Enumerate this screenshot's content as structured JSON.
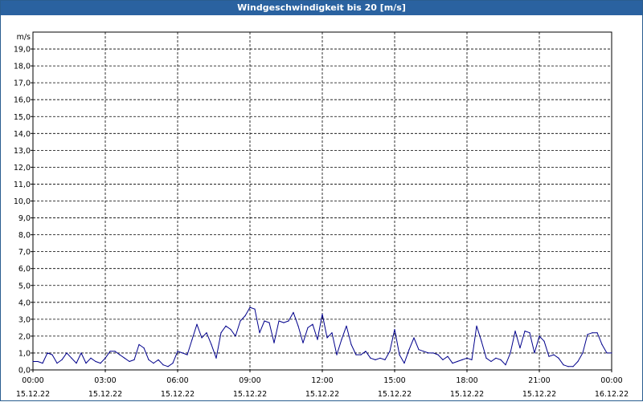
{
  "window": {
    "title": "Windgeschwindigkeit bis 20 [m/s]"
  },
  "chart_data": {
    "type": "line",
    "title": "Windgeschwindigkeit bis 20 [m/s]",
    "ylabel": "m/s",
    "ylim": [
      0,
      20
    ],
    "xlim_hours": [
      0,
      24
    ],
    "grid": true,
    "yticks": [
      "0,0",
      "1,0",
      "2,0",
      "3,0",
      "4,0",
      "5,0",
      "6,0",
      "7,0",
      "8,0",
      "9,0",
      "10,0",
      "11,0",
      "12,0",
      "13,0",
      "14,0",
      "15,0",
      "16,0",
      "17,0",
      "18,0",
      "19,0"
    ],
    "xticks": [
      {
        "time": "00:00",
        "date": "15.12.22"
      },
      {
        "time": "03:00",
        "date": "15.12.22"
      },
      {
        "time": "06:00",
        "date": "15.12.22"
      },
      {
        "time": "09:00",
        "date": "15.12.22"
      },
      {
        "time": "12:00",
        "date": "15.12.22"
      },
      {
        "time": "15:00",
        "date": "15.12.22"
      },
      {
        "time": "18:00",
        "date": "15.12.22"
      },
      {
        "time": "21:00",
        "date": "15.12.22"
      },
      {
        "time": "00:00",
        "date": "16.12.22"
      }
    ],
    "series": [
      {
        "color": "#00008b",
        "x": [
          0.0,
          0.2,
          0.4,
          0.6,
          0.8,
          1.0,
          1.2,
          1.4,
          1.6,
          1.8,
          2.0,
          2.2,
          2.4,
          2.6,
          2.8,
          3.0,
          3.2,
          3.4,
          3.6,
          3.8,
          4.0,
          4.2,
          4.4,
          4.6,
          4.8,
          5.0,
          5.2,
          5.4,
          5.6,
          5.8,
          6.0,
          6.2,
          6.4,
          6.6,
          6.8,
          7.0,
          7.2,
          7.4,
          7.6,
          7.8,
          8.0,
          8.2,
          8.4,
          8.6,
          8.8,
          9.0,
          9.2,
          9.4,
          9.6,
          9.8,
          10.0,
          10.2,
          10.4,
          10.6,
          10.8,
          11.0,
          11.2,
          11.4,
          11.6,
          11.8,
          12.0,
          12.2,
          12.4,
          12.6,
          12.8,
          13.0,
          13.2,
          13.4,
          13.6,
          13.8,
          14.0,
          14.2,
          14.4,
          14.6,
          14.8,
          15.0,
          15.2,
          15.4,
          15.6,
          15.8,
          16.0,
          16.2,
          16.4,
          16.6,
          16.8,
          17.0,
          17.2,
          17.4,
          17.6,
          17.8,
          18.0,
          18.2,
          18.4,
          18.6,
          18.8,
          19.0,
          19.2,
          19.4,
          19.6,
          19.8,
          20.0,
          20.2,
          20.4,
          20.6,
          20.8,
          21.0,
          21.2,
          21.4,
          21.6,
          21.8,
          22.0,
          22.2,
          22.4,
          22.6,
          22.8,
          23.0,
          23.2,
          23.4,
          23.6,
          23.8,
          24.0
        ],
        "values": [
          0.5,
          0.5,
          0.4,
          1.0,
          0.9,
          0.4,
          0.6,
          1.0,
          0.7,
          0.4,
          1.0,
          0.4,
          0.7,
          0.5,
          0.4,
          0.7,
          1.1,
          1.1,
          0.9,
          0.7,
          0.5,
          0.6,
          1.5,
          1.3,
          0.6,
          0.4,
          0.6,
          0.3,
          0.2,
          0.4,
          1.1,
          1.0,
          0.9,
          1.8,
          2.7,
          1.9,
          2.2,
          1.5,
          0.7,
          2.2,
          2.6,
          2.4,
          2.0,
          2.9,
          3.2,
          3.7,
          3.6,
          2.2,
          2.9,
          2.8,
          1.6,
          2.9,
          2.8,
          2.9,
          3.4,
          2.6,
          1.6,
          2.5,
          2.7,
          1.8,
          3.3,
          1.9,
          2.2,
          0.9,
          1.8,
          2.6,
          1.5,
          0.9,
          0.9,
          1.1,
          0.7,
          0.6,
          0.7,
          0.6,
          1.1,
          2.4,
          0.9,
          0.4,
          1.2,
          1.9,
          1.2,
          1.1,
          1.0,
          1.0,
          0.9,
          0.6,
          0.8,
          0.4,
          0.5,
          0.6,
          0.7,
          0.6,
          2.6,
          1.7,
          0.7,
          0.5,
          0.7,
          0.6,
          0.3,
          1.0,
          2.3,
          1.3,
          2.3,
          2.2,
          1.0,
          2.0,
          1.7,
          0.8,
          0.9,
          0.7,
          0.3,
          0.2,
          0.2,
          0.5,
          1.0,
          2.1,
          2.2,
          2.2,
          1.5,
          1.0,
          1.0
        ]
      }
    ]
  }
}
